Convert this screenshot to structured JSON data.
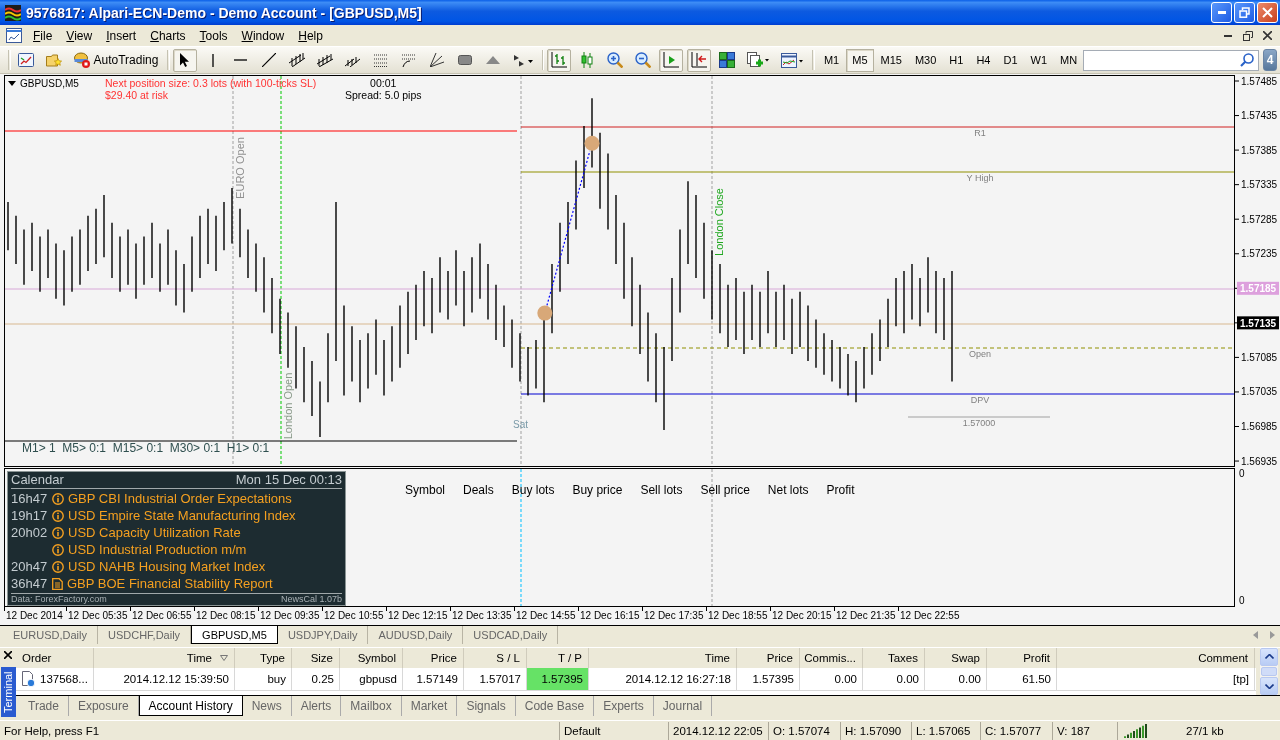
{
  "window": {
    "title": "9576817: Alpari-ECN-Demo - Demo Account - [GBPUSD,M5]"
  },
  "menu": {
    "items": [
      "File",
      "View",
      "Insert",
      "Charts",
      "Tools",
      "Window",
      "Help"
    ]
  },
  "toolbar": {
    "groups": [
      {
        "buttons": [
          {
            "pressed": false
          },
          {
            "pressed": false
          },
          {
            "label": "AutoTrading",
            "pressed": false
          }
        ]
      },
      {
        "buttons": [
          {
            "pressed": true
          },
          {
            "pressed": false
          },
          {
            "pressed": false
          },
          {
            "pressed": false
          },
          {
            "pressed": false
          },
          {
            "pressed": false
          },
          {
            "pressed": false
          },
          {
            "pressed": false
          },
          {
            "pressed": false
          },
          {
            "pressed": false
          },
          {
            "pressed": false
          },
          {
            "pressed": false
          },
          {
            "pressed": false
          }
        ]
      },
      {
        "buttons": [
          {
            "pressed": true
          },
          {
            "pressed": false
          },
          {
            "pressed": false
          },
          {
            "pressed": false
          },
          {
            "pressed": true
          },
          {
            "pressed": true
          },
          {
            "pressed": false
          },
          {
            "pressed": false
          },
          {
            "pressed": false
          }
        ]
      }
    ],
    "timeframes": [
      {
        "label": "M1",
        "selected": false
      },
      {
        "label": "M5",
        "selected": true
      },
      {
        "label": "M15",
        "selected": false
      },
      {
        "label": "M30",
        "selected": false
      },
      {
        "label": "H1",
        "selected": false
      },
      {
        "label": "H4",
        "selected": false
      },
      {
        "label": "D1",
        "selected": false
      },
      {
        "label": "W1",
        "selected": false
      },
      {
        "label": "MN",
        "selected": false
      }
    ],
    "messages": "4"
  },
  "chart": {
    "symbol": "GBPUSD,M5",
    "position_info": [
      "Next position size: 0.3 lots (with 100-ticks SL)",
      "$29.40 at risk"
    ],
    "countdown": "00:01",
    "spread": "Spread: 5.0 pips",
    "session_labels": [
      {
        "text": "EURO Open",
        "color": "#909090"
      },
      {
        "text": "London Open",
        "color": "#8a9a8a"
      },
      {
        "text": "London Close",
        "color": "#20a820"
      }
    ],
    "level_labels": [
      "R1",
      "Y High",
      "Open",
      "DPV",
      "1.57000"
    ],
    "day_label": "Sat",
    "timeframe_stats": "M1> 1  M5> 0:1  M15> 0:1  M30> 0:1  H1> 0:1",
    "price_axis": [
      "1.57485",
      "1.57435",
      "1.57385",
      "1.57335",
      "1.57285",
      "1.57235",
      "1.57085",
      "1.57035",
      "1.56985",
      "1.56935"
    ],
    "price_tags": [
      {
        "text": "1.57185",
        "color": "#dda0dd"
      },
      {
        "text": "1.57135",
        "color": "#000000"
      }
    ],
    "time_axis": [
      "12 Dec 2014",
      "12 Dec 05:35",
      "12 Dec 06:55",
      "12 Dec 08:15",
      "12 Dec 09:35",
      "12 Dec 10:55",
      "12 Dec 12:15",
      "12 Dec 13:35",
      "12 Dec 14:55",
      "12 Dec 16:15",
      "12 Dec 17:35",
      "12 Dec 18:55",
      "12 Dec 20:15",
      "12 Dec 21:35",
      "12 Dec 22:55"
    ]
  },
  "indicator_window": {
    "calendar": {
      "title": "Calendar",
      "date": "Mon 15 Dec 00:13",
      "events": [
        {
          "time": "16h47",
          "kind": "info",
          "text": "GBP CBI Industrial Order Expectations"
        },
        {
          "time": "19h17",
          "kind": "info",
          "text": "USD Empire State Manufacturing Index"
        },
        {
          "time": "20h02",
          "kind": "info",
          "text": "USD Capacity Utilization Rate"
        },
        {
          "kind": "info",
          "text": "USD Industrial Production m/m"
        },
        {
          "time": "20h47",
          "kind": "info",
          "text": "USD NAHB Housing Market Index"
        },
        {
          "time": "36h47",
          "kind": "report",
          "text": "GBP BOE Financial Stability Report"
        }
      ],
      "source": "Data: ForexFactory.com",
      "version": "NewsCal 1.07b"
    },
    "columns": [
      "Symbol",
      "Deals",
      "Buy lots",
      "Buy price",
      "Sell lots",
      "Sell price",
      "Net lots",
      "Profit"
    ],
    "axis_labels": [
      "0",
      "0"
    ]
  },
  "chart_tabs": [
    {
      "label": "EURUSD,Daily",
      "selected": false
    },
    {
      "label": "USDCHF,Daily",
      "selected": false
    },
    {
      "label": "GBPUSD,M5",
      "selected": true
    },
    {
      "label": "USDJPY,Daily",
      "selected": false
    },
    {
      "label": "AUDUSD,Daily",
      "selected": false
    },
    {
      "label": "USDCAD,Daily",
      "selected": false
    }
  ],
  "terminal": {
    "title": "Terminal",
    "columns": [
      {
        "label": "Order",
        "sorted": false
      },
      {
        "label": "Time",
        "sorted": true
      },
      {
        "label": "Type",
        "sorted": false
      },
      {
        "label": "Size",
        "sorted": false
      },
      {
        "label": "Symbol",
        "sorted": false
      },
      {
        "label": "Price",
        "sorted": false
      },
      {
        "label": "S / L",
        "sorted": false
      },
      {
        "label": "T / P",
        "sorted": false
      },
      {
        "label": "Time",
        "sorted": false
      },
      {
        "label": "Price",
        "sorted": false
      },
      {
        "label": "Commis...",
        "sorted": false
      },
      {
        "label": "Taxes",
        "sorted": false
      },
      {
        "label": "Swap",
        "sorted": false
      },
      {
        "label": "Profit",
        "sorted": false
      },
      {
        "label": "Comment",
        "sorted": false
      }
    ],
    "rows": [
      {
        "cells": [
          {
            "text": "137568...",
            "highlighted": false
          },
          {
            "text": "2014.12.12 15:39:50",
            "highlighted": false
          },
          {
            "text": "buy",
            "highlighted": false
          },
          {
            "text": "0.25",
            "highlighted": false
          },
          {
            "text": "gbpusd",
            "highlighted": false
          },
          {
            "text": "1.57149",
            "highlighted": false
          },
          {
            "text": "1.57017",
            "highlighted": false
          },
          {
            "text": "1.57395",
            "highlighted": true
          },
          {
            "text": "2014.12.12 16:27:18",
            "highlighted": false
          },
          {
            "text": "1.57395",
            "highlighted": false
          },
          {
            "text": "0.00",
            "highlighted": false
          },
          {
            "text": "0.00",
            "highlighted": false
          },
          {
            "text": "0.00",
            "highlighted": false
          },
          {
            "text": "61.50",
            "highlighted": false
          },
          {
            "text": "[tp]",
            "highlighted": false
          }
        ]
      }
    ],
    "tabs": [
      {
        "label": "Trade",
        "selected": false
      },
      {
        "label": "Exposure",
        "selected": false
      },
      {
        "label": "Account History",
        "selected": true
      },
      {
        "label": "News",
        "selected": false
      },
      {
        "label": "Alerts",
        "selected": false
      },
      {
        "label": "Mailbox",
        "selected": false
      },
      {
        "label": "Market",
        "selected": false
      },
      {
        "label": "Signals",
        "selected": false
      },
      {
        "label": "Code Base",
        "selected": false
      },
      {
        "label": "Experts",
        "selected": false
      },
      {
        "label": "Journal",
        "selected": false
      }
    ]
  },
  "status_bar": {
    "items": [
      "For Help, press F1",
      "Default",
      "2014.12.12 22:05",
      "O: 1.57074",
      "H: 1.57090",
      "L: 1.57065",
      "C: 1.57077",
      "V: 187"
    ],
    "traffic": "27/1 kb"
  }
}
